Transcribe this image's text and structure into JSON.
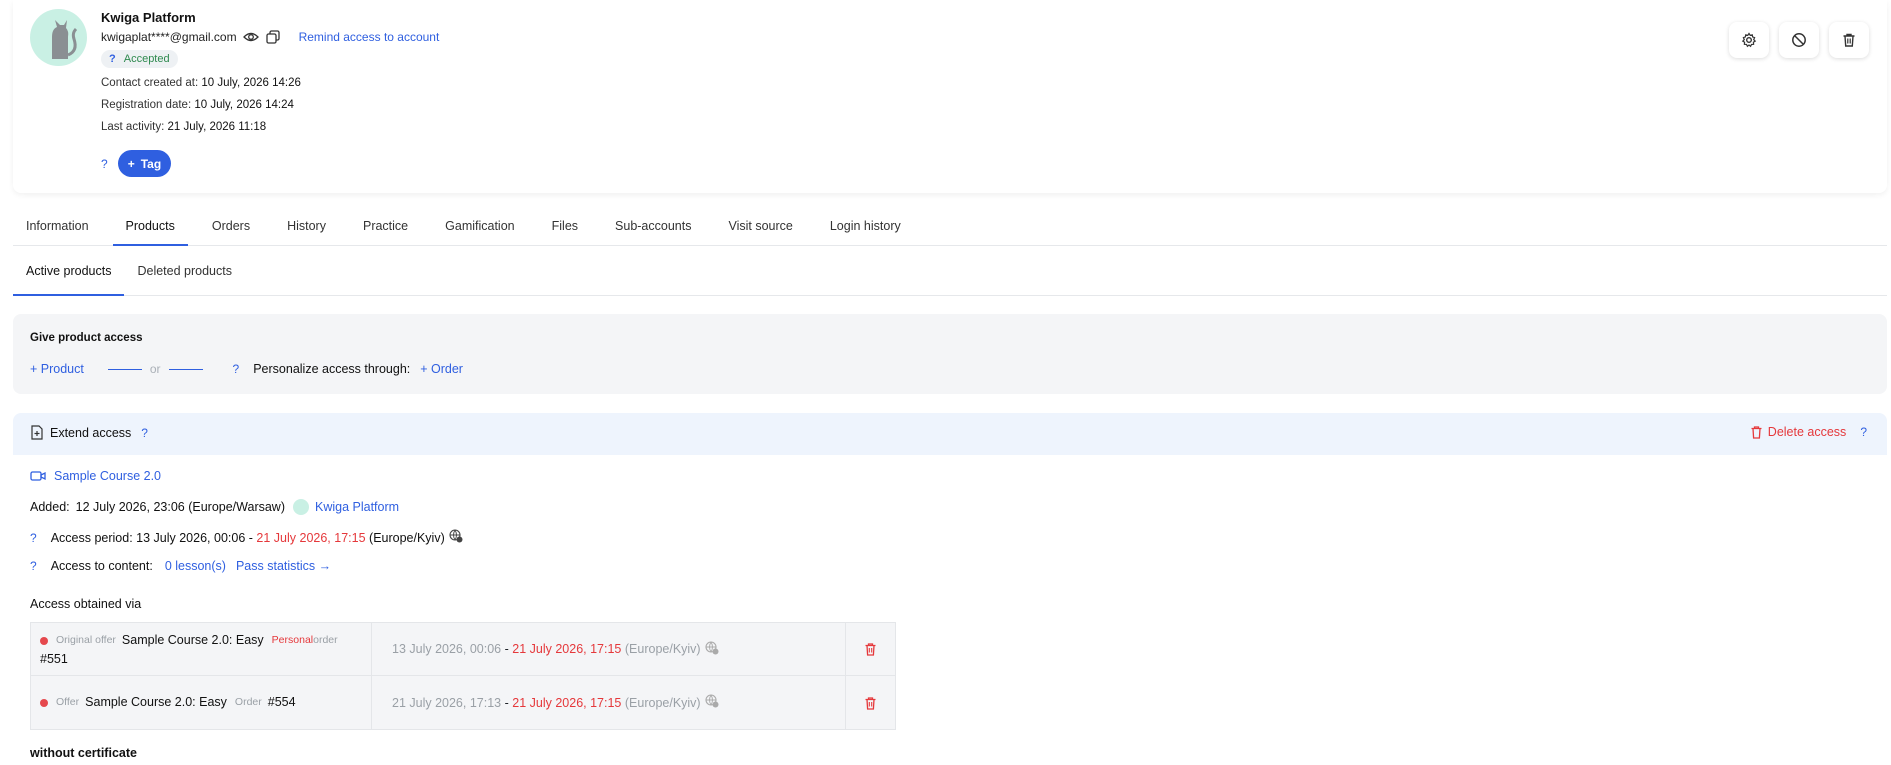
{
  "profile": {
    "name": "Kwiga Platform",
    "email": "kwigaplat****@gmail.com",
    "remind_link": "Remind access to account",
    "status_q": "?",
    "status": "Accepted",
    "contact_created_label": "Contact created at:",
    "contact_created_value": "10 July, 2026 14:26",
    "registration_label": "Registration date:",
    "registration_value": "10 July, 2026 14:24",
    "last_activity_label": "Last activity:",
    "last_activity_value": "21 July, 2026 11:18",
    "tag_q": "?",
    "tag_button": "Tag"
  },
  "tabs": [
    "Information",
    "Products",
    "Orders",
    "History",
    "Practice",
    "Gamification",
    "Files",
    "Sub-accounts",
    "Visit source",
    "Login history"
  ],
  "subtabs": [
    "Active products",
    "Deleted products"
  ],
  "give_access": {
    "title": "Give product access",
    "product_link": "+ Product",
    "or": "or",
    "q": "?",
    "personalize_label": "Personalize access through:",
    "order_link": "+ Order"
  },
  "extend": {
    "label": "Extend access",
    "q": "?",
    "delete_label": "Delete access",
    "delete_q": "?"
  },
  "product": {
    "title": "Sample Course 2.0",
    "added_label": "Added:",
    "added_value": "12 July 2026, 23:06 (Europe/Warsaw)",
    "added_by": "Kwiga Platform",
    "period_q": "?",
    "period_label": "Access period:",
    "period_start": "13 July 2026, 00:06",
    "period_sep": "-",
    "period_end": "21 July 2026, 17:15",
    "period_tz": "(Europe/Kyiv)",
    "content_q": "?",
    "content_label": "Access to content:",
    "lessons_link": "0 lesson(s)",
    "stats_link": "Pass statistics →",
    "obtained_label": "Access obtained via"
  },
  "access_rows": [
    {
      "type_label": "Original offer",
      "offer_name": "Sample Course 2.0: Easy",
      "personal_badge": "Personal",
      "order_label": "order",
      "order_number": "#551",
      "start": "13 July 2026, 00:06",
      "sep": "-",
      "end": "21 July 2026, 17:15",
      "tz": "(Europe/Kyiv)"
    },
    {
      "type_label": "Offer",
      "offer_name": "Sample Course 2.0: Easy",
      "personal_badge": "",
      "order_label": "Order",
      "order_number": "#554",
      "start": "21 July 2026, 17:13",
      "sep": "-",
      "end": "21 July 2026, 17:15",
      "tz": "(Europe/Kyiv)"
    }
  ],
  "certificate": "without certificate",
  "colors": {
    "accent": "#2f5fe0",
    "danger": "#e5383b",
    "success": "#2f8a4f"
  }
}
